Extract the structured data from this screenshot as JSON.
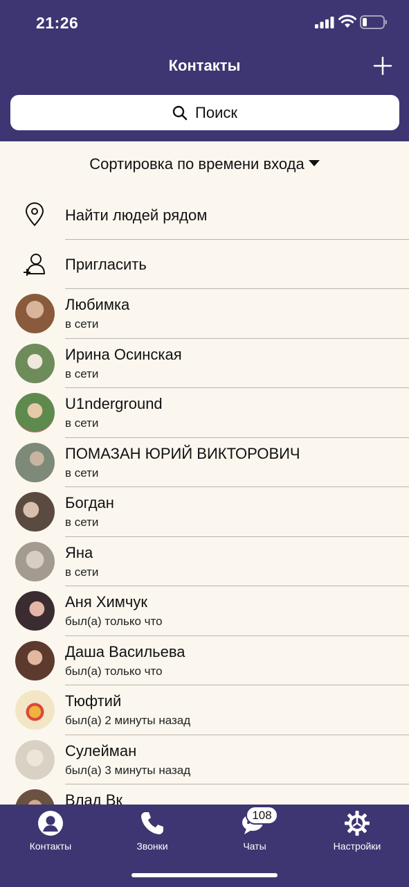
{
  "status_bar": {
    "time": "21:26"
  },
  "header": {
    "title": "Контакты",
    "add_icon": "plus-icon"
  },
  "search": {
    "placeholder": "Поиск",
    "icon": "search-icon"
  },
  "sort": {
    "label": "Сортировка по времени входа"
  },
  "actions": [
    {
      "label": "Найти людей рядом",
      "icon": "location-pin-icon"
    },
    {
      "label": "Пригласить",
      "icon": "add-user-icon"
    }
  ],
  "contacts": [
    {
      "name": "Любимка",
      "status": "в сети",
      "avatar_color": "#8a5a3c"
    },
    {
      "name": "Ирина Осинская",
      "status": "в сети",
      "avatar_color": "#6e8c5a"
    },
    {
      "name": "U1nderground",
      "status": "в сети",
      "avatar_color": "#5f8a4e"
    },
    {
      "name": "ПОМАЗАН ЮРИЙ ВИКТОРОВИЧ",
      "status": "в сети",
      "avatar_color": "#7d8a7a"
    },
    {
      "name": "Богдан",
      "status": "в сети",
      "avatar_color": "#5a4a3f"
    },
    {
      "name": "Яна",
      "status": "в сети",
      "avatar_color": "#a39a90"
    },
    {
      "name": "Аня Химчук",
      "status": "был(а) только что",
      "avatar_color": "#3a2c30"
    },
    {
      "name": "Даша Васильева",
      "status": "был(а) только что",
      "avatar_color": "#5d3a2e"
    },
    {
      "name": "Тюфтий",
      "status": "был(а) 2 минуты назад",
      "avatar_color": "#f2e6c6"
    },
    {
      "name": "Сулейман",
      "status": "был(а) 3 минуты назад",
      "avatar_color": "#d9d2c4"
    },
    {
      "name": "Влад Вк",
      "status": "",
      "avatar_color": "#6a5142"
    }
  ],
  "tabbar": {
    "tabs": [
      {
        "label": "Контакты",
        "icon": "contacts-icon"
      },
      {
        "label": "Звонки",
        "icon": "phone-icon"
      },
      {
        "label": "Чаты",
        "icon": "chat-icon"
      },
      {
        "label": "Настройки",
        "icon": "settings-icon"
      }
    ],
    "chats_badge": "108"
  },
  "colors": {
    "header_bg": "#3d3672",
    "page_bg": "#fbf7ef"
  }
}
